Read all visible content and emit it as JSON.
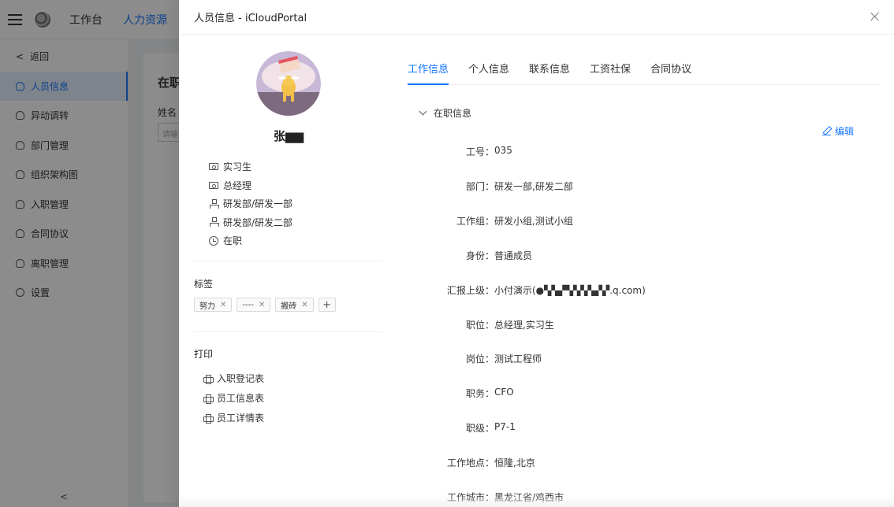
{
  "app": {
    "nav": [
      "工作台",
      "人力资源"
    ],
    "sidebar": [
      "返回",
      "人员信息",
      "异动调转",
      "部门管理",
      "组织架构图",
      "入职管理",
      "合同协议",
      "离职管理",
      "设置"
    ],
    "content": {
      "title": "在职",
      "filter_label": "姓名",
      "filter_placeholder": "请输"
    }
  },
  "drawer": {
    "title": "人员信息 - iCloudPortal",
    "user": {
      "name": "张▆▆",
      "info": [
        {
          "icon": "id-card-icon",
          "text": "实习生"
        },
        {
          "icon": "id-card-icon",
          "text": "总经理"
        },
        {
          "icon": "org-icon",
          "text": "研发部/研发一部"
        },
        {
          "icon": "org-icon",
          "text": "研发部/研发二部"
        },
        {
          "icon": "clock-icon",
          "text": "在职"
        }
      ]
    },
    "tags_title": "标签",
    "tags": [
      "努力",
      "----",
      "搬砖"
    ],
    "add_tag": "+",
    "print_title": "打印",
    "print_items": [
      "入职登记表",
      "员工信息表",
      "员工详情表"
    ],
    "tabs": [
      "工作信息",
      "个人信息",
      "联系信息",
      "工资社保",
      "合同协议"
    ],
    "active_tab": "工作信息",
    "section_title": "在职信息",
    "edit_label": "编辑",
    "fields": [
      {
        "label": "工号：",
        "value": "035"
      },
      {
        "label": "部门：",
        "value": "研发一部,研发二部"
      },
      {
        "label": "工作组：",
        "value": "研发小组,测试小组"
      },
      {
        "label": "身份：",
        "value": "普通成员"
      },
      {
        "label": "汇报上级：",
        "value": "小付演示(●▚▚▞▚▚▚▚▞▞.q.com)"
      },
      {
        "label": "职位：",
        "value": "总经理,实习生"
      },
      {
        "label": "岗位：",
        "value": "测试工程师"
      },
      {
        "label": "职务：",
        "value": "CFO"
      },
      {
        "label": "职级：",
        "value": "P7-1"
      },
      {
        "label": "工作地点：",
        "value": "恒隆,北京"
      },
      {
        "label": "工作城市：",
        "value": "黑龙江省/鸡西市"
      }
    ],
    "colors": {
      "accent": "#1677ff"
    }
  }
}
